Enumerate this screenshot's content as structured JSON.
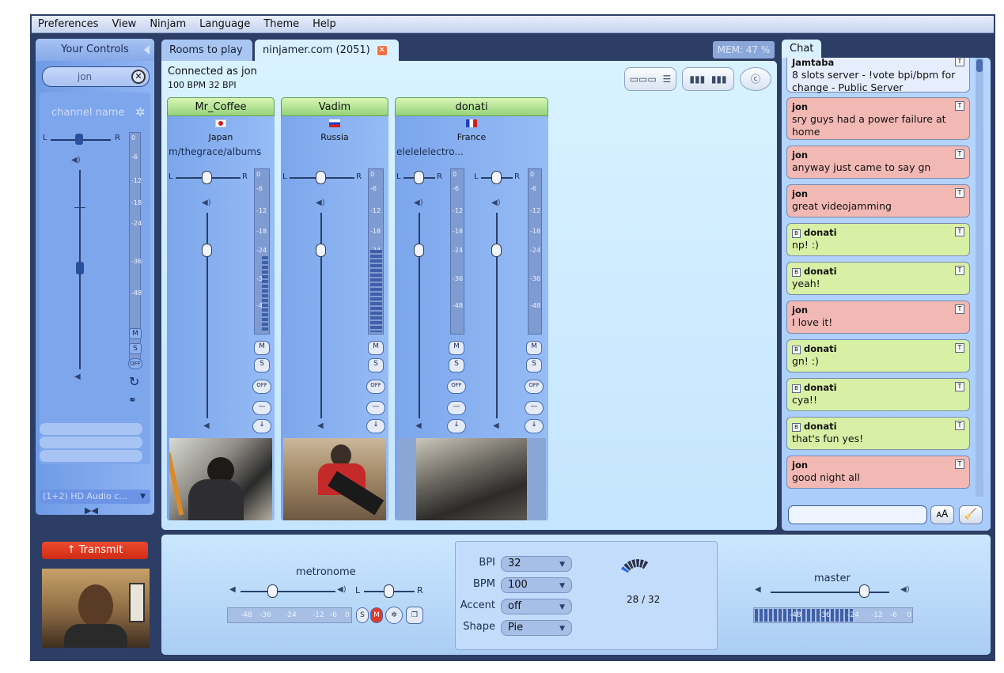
{
  "menu": [
    "Preferences",
    "View",
    "Ninjam",
    "Language",
    "Theme",
    "Help"
  ],
  "left": {
    "title": "Your Controls",
    "nick": "jon",
    "channel_name": "channel name",
    "pan_l": "L",
    "pan_r": "R",
    "meter_ticks": [
      "0",
      "-6",
      "-12",
      "-18",
      "-24",
      "-36",
      "-48"
    ],
    "mute": "M",
    "solo": "S",
    "off": "OFF",
    "audio_input": "(1+2) HD Audio c...",
    "transmit": "Transmit"
  },
  "tabs": [
    {
      "label": "Rooms to play",
      "active": false
    },
    {
      "label": "ninjamer.com (2051)",
      "active": true
    }
  ],
  "mem": "MEM: 47 %",
  "room": {
    "connected_as": "Connected as jon",
    "bpm_bpi": "100 BPM  32 BPI",
    "users": [
      {
        "name": "Mr_Coffee",
        "country": "Japan",
        "channels": [
          "m/thegrace/albums"
        ]
      },
      {
        "name": "Vadim",
        "country": "Russia",
        "channels": [
          ""
        ]
      },
      {
        "name": "donati",
        "country": "France",
        "channels": [
          "elelelelectro..."
        ]
      }
    ],
    "strip_ticks": [
      "0",
      "-6",
      "-12",
      "-18",
      "-24",
      "-36",
      "-48"
    ],
    "pan_l": "L",
    "pan_r": "R",
    "mute": "M",
    "solo": "S",
    "off": "OFF"
  },
  "chat": {
    "tab": "Chat",
    "messages": [
      {
        "user": "Jamtaba",
        "text": "8 slots server - !vote bpi/bpm for change - Public Server",
        "kind": "intro"
      },
      {
        "user": "jon",
        "text": "sry guys had a power failure at home",
        "kind": "jon"
      },
      {
        "user": "jon",
        "text": "anyway just came to say gn",
        "kind": "jon"
      },
      {
        "user": "jon",
        "text": "great videojamming",
        "kind": "jon"
      },
      {
        "user": "donati",
        "text": "np! :)",
        "kind": "donati"
      },
      {
        "user": "donati",
        "text": "yeah!",
        "kind": "donati"
      },
      {
        "user": "jon",
        "text": "I love it!",
        "kind": "jon"
      },
      {
        "user": "donati",
        "text": "gn! :)",
        "kind": "donati"
      },
      {
        "user": "donati",
        "text": "cya!!",
        "kind": "donati"
      },
      {
        "user": "donati",
        "text": "that's fun yes!",
        "kind": "donati"
      },
      {
        "user": "jon",
        "text": "good night all",
        "kind": "jon"
      }
    ],
    "badge_t": "T",
    "badge_b": "B"
  },
  "bottom": {
    "metronome": "metronome",
    "master": "master",
    "pan_l": "L",
    "pan_r": "R",
    "meter_ticks": [
      "-48",
      "-36",
      "-24",
      "-12",
      "-6",
      "0"
    ],
    "solo": "S",
    "mute": "M",
    "settings": {
      "bpi_label": "BPI",
      "bpi_value": "32",
      "bpm_label": "BPM",
      "bpm_value": "100",
      "accent_label": "Accent",
      "accent_value": "off",
      "shape_label": "Shape",
      "shape_value": "Pie"
    },
    "beat": "28 / 32",
    "interval_progress": 0.875
  },
  "colors": {
    "transmit": "#d9341c",
    "jon_msg": "#f2b8b4",
    "donati_msg": "#d7f0a5",
    "strip_header": "#b9e89a"
  }
}
